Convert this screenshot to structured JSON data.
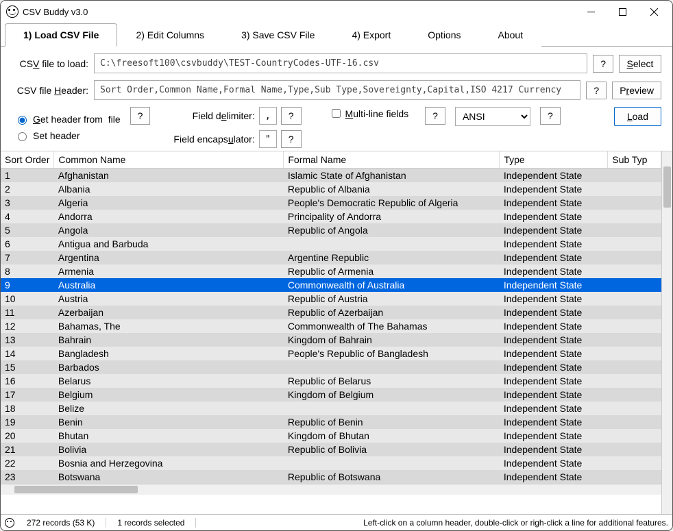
{
  "window": {
    "title": "CSV Buddy v3.0"
  },
  "tabs": [
    {
      "label": "1) Load CSV File",
      "active": true
    },
    {
      "label": "2) Edit Columns"
    },
    {
      "label": "3) Save CSV File"
    },
    {
      "label": "4) Export"
    },
    {
      "label": "Options"
    },
    {
      "label": "About"
    }
  ],
  "fields": {
    "file_to_load_label": "CSV file to load:",
    "file_to_load_value": "C:\\freesoft100\\csvbuddy\\TEST-CountryCodes-UTF-16.csv",
    "header_label": "CSV file Header:",
    "header_value": "Sort Order,Common Name,Formal Name,Type,Sub Type,Sovereignty,Capital,ISO 4217 Currency",
    "get_header_label": "Get header from  file",
    "set_header_label": "Set header",
    "field_delim_label": "Field delimiter:",
    "field_delim_value": ",",
    "field_encap_label": "Field encapsulator:",
    "field_encap_value": "\"",
    "multiline_label": "Multi-line fields",
    "encoding": "ANSI"
  },
  "buttons": {
    "help": "?",
    "select": "Select",
    "preview": "Preview",
    "load": "Load"
  },
  "table": {
    "columns": [
      "Sort Order",
      "Common Name",
      "Formal Name",
      "Type",
      "Sub Typ"
    ],
    "selected_index": 8,
    "rows": [
      {
        "sort": "1",
        "common": "Afghanistan",
        "formal": "Islamic State of Afghanistan",
        "type": "Independent State"
      },
      {
        "sort": "2",
        "common": "Albania",
        "formal": "Republic of Albania",
        "type": "Independent State"
      },
      {
        "sort": "3",
        "common": "Algeria",
        "formal": "People's Democratic Republic of Algeria",
        "type": "Independent State"
      },
      {
        "sort": "4",
        "common": "Andorra",
        "formal": "Principality of Andorra",
        "type": "Independent State"
      },
      {
        "sort": "5",
        "common": "Angola",
        "formal": "Republic of Angola",
        "type": "Independent State"
      },
      {
        "sort": "6",
        "common": "Antigua and Barbuda",
        "formal": "",
        "type": "Independent State"
      },
      {
        "sort": "7",
        "common": "Argentina",
        "formal": "Argentine Republic",
        "type": "Independent State"
      },
      {
        "sort": "8",
        "common": "Armenia",
        "formal": "Republic of Armenia",
        "type": "Independent State"
      },
      {
        "sort": "9",
        "common": "Australia",
        "formal": "Commonwealth of Australia",
        "type": "Independent State"
      },
      {
        "sort": "10",
        "common": "Austria",
        "formal": "Republic of Austria",
        "type": "Independent State"
      },
      {
        "sort": "11",
        "common": "Azerbaijan",
        "formal": "Republic of Azerbaijan",
        "type": "Independent State"
      },
      {
        "sort": "12",
        "common": "Bahamas, The",
        "formal": "Commonwealth of The Bahamas",
        "type": "Independent State"
      },
      {
        "sort": "13",
        "common": "Bahrain",
        "formal": "Kingdom of Bahrain",
        "type": "Independent State"
      },
      {
        "sort": "14",
        "common": "Bangladesh",
        "formal": "People's Republic of Bangladesh",
        "type": "Independent State"
      },
      {
        "sort": "15",
        "common": "Barbados",
        "formal": "",
        "type": "Independent State"
      },
      {
        "sort": "16",
        "common": "Belarus",
        "formal": "Republic of Belarus",
        "type": "Independent State"
      },
      {
        "sort": "17",
        "common": "Belgium",
        "formal": "Kingdom of Belgium",
        "type": "Independent State"
      },
      {
        "sort": "18",
        "common": "Belize",
        "formal": "",
        "type": "Independent State"
      },
      {
        "sort": "19",
        "common": "Benin",
        "formal": "Republic of Benin",
        "type": "Independent State"
      },
      {
        "sort": "20",
        "common": "Bhutan",
        "formal": "Kingdom of Bhutan",
        "type": "Independent State"
      },
      {
        "sort": "21",
        "common": "Bolivia",
        "formal": "Republic of Bolivia",
        "type": "Independent State"
      },
      {
        "sort": "22",
        "common": "Bosnia and Herzegovina",
        "formal": "",
        "type": "Independent State"
      },
      {
        "sort": "23",
        "common": "Botswana",
        "formal": "Republic of Botswana",
        "type": "Independent State"
      }
    ]
  },
  "status": {
    "records": "272 records (53 K)",
    "selected": "1 records selected",
    "hint": "Left-click on a column header, double-click or righ-click a line for additional features."
  }
}
